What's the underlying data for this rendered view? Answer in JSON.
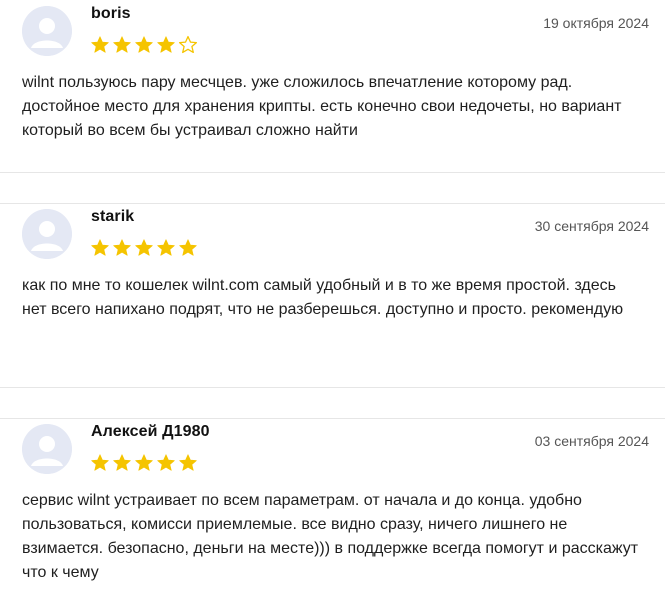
{
  "reviews": [
    {
      "author": "boris",
      "date": "19 октября 2024",
      "rating": 4,
      "max_rating": 5,
      "text": "wilnt пользуюсь пару месчцев. уже сложилось впечатление которому рад. достойное место для хранения крипты. есть конечно свои недочеты, но вариант который во всем бы устраивал сложно найти"
    },
    {
      "author": "starik",
      "date": "30 сентября 2024",
      "rating": 5,
      "max_rating": 5,
      "text": "как по мне то кошелек wilnt.com самый удобный и в то же время простой. здесь нет всего напихано подрят, что не разберешься. доступно и просто. рекомендую"
    },
    {
      "author": "Алексей Д1980",
      "date": "03 сентября 2024",
      "rating": 5,
      "max_rating": 5,
      "text": "сервис wilnt устраивает по всем параметрам. от начала и до конца. удобно пользоваться, комисси приемлемые. все видно сразу, ничего лишнего не взимается. безопасно, деньги на месте))) в поддержке всегда помогут и расскажут что к чему"
    }
  ],
  "colors": {
    "star_filled": "#f5c400",
    "star_empty": "#f5c400",
    "avatar_bg": "#e4e8f4",
    "avatar_fg": "#ffffff",
    "divider": "#e6e6e6"
  },
  "icons": {
    "avatar": "user-placeholder-icon",
    "star_filled": "star-filled-icon",
    "star_empty": "star-outline-icon"
  }
}
